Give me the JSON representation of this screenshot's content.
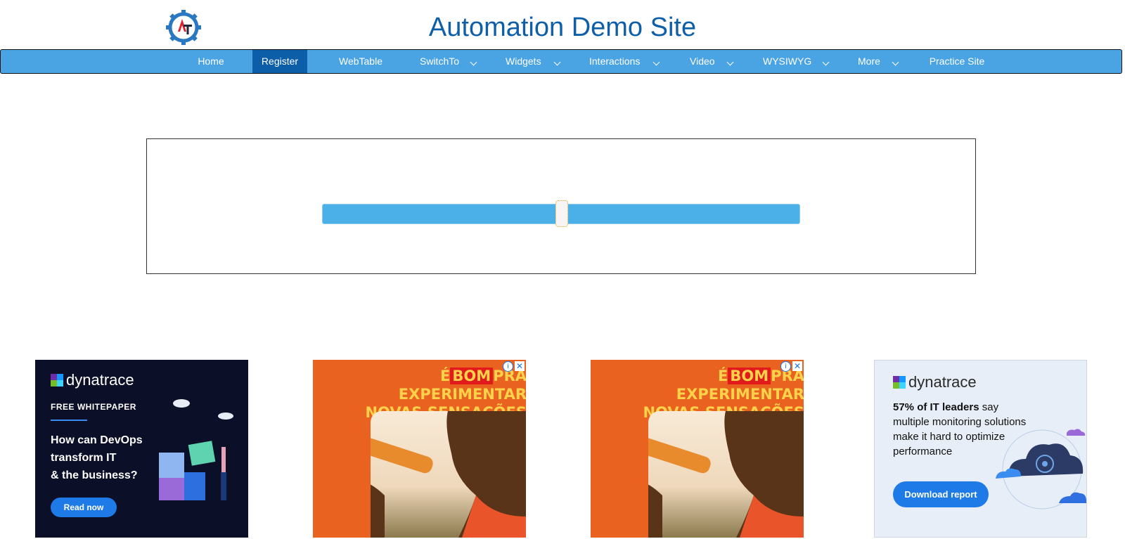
{
  "site": {
    "title": "Automation Demo Site"
  },
  "nav": {
    "items": [
      {
        "label": "Home",
        "active": false,
        "has_dropdown": false
      },
      {
        "label": "Register",
        "active": true,
        "has_dropdown": false
      },
      {
        "label": "WebTable",
        "active": false,
        "has_dropdown": false
      },
      {
        "label": "SwitchTo",
        "active": false,
        "has_dropdown": true
      },
      {
        "label": "Widgets",
        "active": false,
        "has_dropdown": true
      },
      {
        "label": "Interactions",
        "active": false,
        "has_dropdown": true
      },
      {
        "label": "Video",
        "active": false,
        "has_dropdown": true
      },
      {
        "label": "WYSIWYG",
        "active": false,
        "has_dropdown": true
      },
      {
        "label": "More",
        "active": false,
        "has_dropdown": true
      },
      {
        "label": "Practice Site",
        "active": false,
        "has_dropdown": false
      }
    ]
  },
  "slider": {
    "value_fraction": 0.5
  },
  "ads": [
    {
      "brand": "dynatrace",
      "label": "FREE WHITEPAPER",
      "headline": [
        "How can DevOps",
        "transform IT",
        "& the business?"
      ],
      "cta": "Read now"
    },
    {
      "headline_pre": "É",
      "headline_highlight": "BOM",
      "headline_rest": "PRA EXPERIMENTAR",
      "headline_line2": "NOVAS SENSAÇÕES"
    },
    {
      "headline_pre": "É",
      "headline_highlight": "BOM",
      "headline_rest": "PRA EXPERIMENTAR",
      "headline_line2": "NOVAS SENSAÇÕES"
    },
    {
      "brand": "dynatrace",
      "bold": "57% of IT leaders",
      "text": " say multiple monitoring solutions make it hard to optimize performance",
      "cta": "Download report"
    }
  ],
  "colors": {
    "brand": "#0e5fa8",
    "nav": "#4aa3e2",
    "nav_active": "#0d5ea8",
    "slider": "#4cb0e8"
  }
}
